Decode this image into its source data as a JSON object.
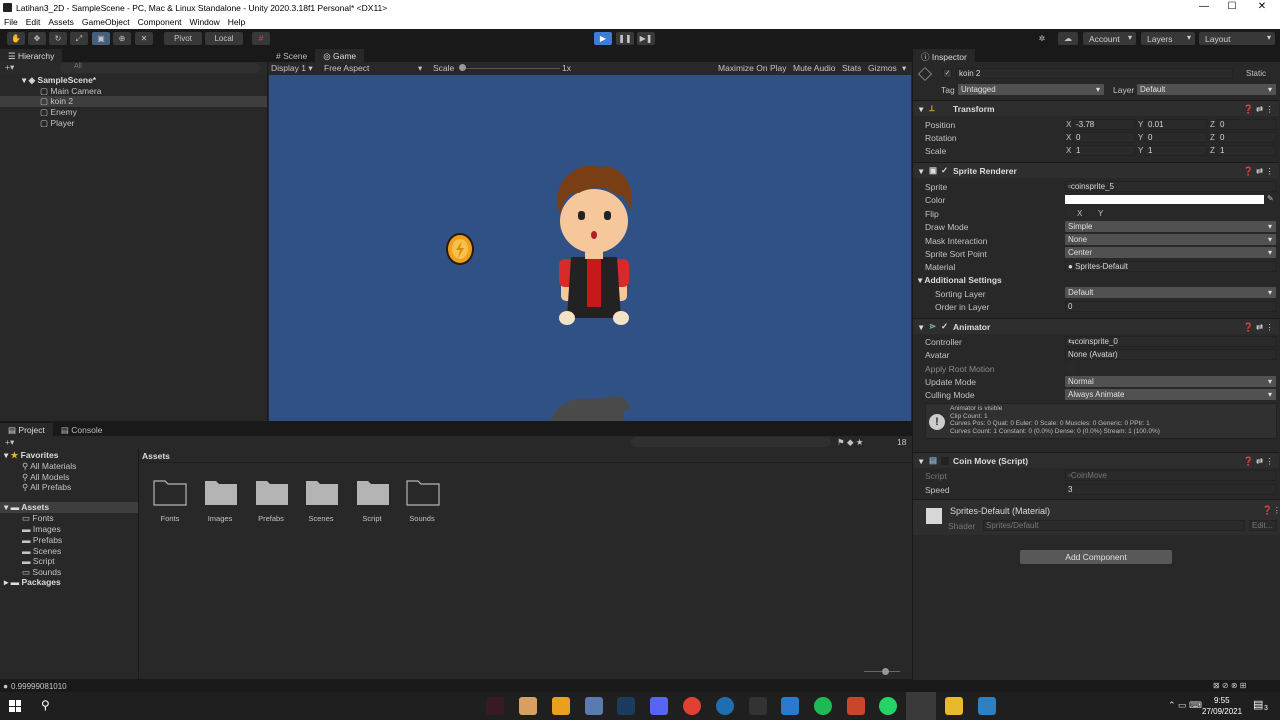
{
  "window": {
    "title": "Latihan3_2D - SampleScene - PC, Mac & Linux Standalone - Unity 2020.3.18f1 Personal* <DX11>",
    "min": "—",
    "max": "☐",
    "close": "✕"
  },
  "menu": [
    "File",
    "Edit",
    "Assets",
    "GameObject",
    "Component",
    "Window",
    "Help"
  ],
  "toolbar": {
    "pivot": "Pivot",
    "local": "Local",
    "account": "Account",
    "layers": "Layers",
    "layout": "Layout"
  },
  "hierarchy": {
    "tab": "Hierarchy",
    "search_placeholder": "All",
    "scene": "SampleScene*",
    "items": [
      "Main Camera",
      "koin 2",
      "Enemy",
      "Player"
    ],
    "selected": "koin 2"
  },
  "game": {
    "tabs": [
      "Scene",
      "Game"
    ],
    "display": "Display 1",
    "aspect": "Free Aspect",
    "scale_label": "Scale",
    "scale_value": "1x",
    "options": [
      "Maximize On Play",
      "Mute Audio",
      "Stats",
      "Gizmos"
    ],
    "bg": "#2f5185"
  },
  "project": {
    "tabs": [
      "Project",
      "Console"
    ],
    "count": "18",
    "favorites": "Favorites",
    "fav_items": [
      "All Materials",
      "All Models",
      "All Prefabs"
    ],
    "assets": "Assets",
    "asset_children": [
      "Fonts",
      "Images",
      "Prefabs",
      "Scenes",
      "Script",
      "Sounds"
    ],
    "packages": "Packages",
    "breadcrumb": "Assets",
    "folders": [
      "Fonts",
      "Images",
      "Prefabs",
      "Scenes",
      "Script",
      "Sounds"
    ]
  },
  "status": {
    "text": "0.99999081010"
  },
  "inspector": {
    "tab": "Inspector",
    "object_name": "koin 2",
    "static": "Static",
    "tag_label": "Tag",
    "tag": "Untagged",
    "layer_label": "Layer",
    "layer": "Default",
    "transform": {
      "title": "Transform",
      "position_label": "Position",
      "rotation_label": "Rotation",
      "scale_label": "Scale",
      "position": {
        "x": "-3.78",
        "y": "0.01",
        "z": "0"
      },
      "rotation": {
        "x": "0",
        "y": "0",
        "z": "0"
      },
      "scale": {
        "x": "1",
        "y": "1",
        "z": "1"
      }
    },
    "sprite_renderer": {
      "title": "Sprite Renderer",
      "sprite_label": "Sprite",
      "sprite": "coinsprite_5",
      "color_label": "Color",
      "flip_label": "Flip",
      "flip_x": "X",
      "flip_y": "Y",
      "draw_mode_label": "Draw Mode",
      "draw_mode": "Simple",
      "mask_label": "Mask Interaction",
      "mask": "None",
      "sort_point_label": "Sprite Sort Point",
      "sort_point": "Center",
      "material_label": "Material",
      "material": "Sprites-Default",
      "additional": "Additional Settings",
      "sorting_layer_label": "Sorting Layer",
      "sorting_layer": "Default",
      "order_label": "Order in Layer",
      "order": "0"
    },
    "animator": {
      "title": "Animator",
      "controller_label": "Controller",
      "controller": "coinsprite_0",
      "avatar_label": "Avatar",
      "avatar": "None (Avatar)",
      "root_motion_label": "Apply Root Motion",
      "update_mode_label": "Update Mode",
      "update_mode": "Normal",
      "culling_label": "Culling Mode",
      "culling": "Always Animate",
      "info": [
        "Animator is visible",
        "Clip Count: 1",
        "Curves Pos: 0 Quat: 0 Euler: 0 Scale: 0 Muscles: 0 Generic: 0 PPtr: 1",
        "Curves Count: 1 Constant: 0 (0.0%) Dense: 0 (0.0%) Stream: 1 (100.0%)"
      ]
    },
    "coin_move": {
      "title": "Coin Move (Script)",
      "script_label": "Script",
      "script": "CoinMove",
      "speed_label": "Speed",
      "speed": "3"
    },
    "material": {
      "title": "Sprites-Default (Material)",
      "shader_label": "Shader",
      "shader": "Sprites/Default",
      "edit": "Edit..."
    },
    "add_component": "Add Component"
  },
  "taskbar": {
    "time": "9:55",
    "date": "27/09/2021",
    "notif": "3"
  },
  "icons": [
    "unity-icon",
    "play-icon",
    "pause-icon",
    "step-icon",
    "hand-tool-icon",
    "move-tool-icon",
    "rotate-tool-icon",
    "scale-tool-icon",
    "rect-tool-icon",
    "transform-tool-icon",
    "custom-tool-icon",
    "folder-icon",
    "windows-start-icon",
    "search-icon"
  ]
}
